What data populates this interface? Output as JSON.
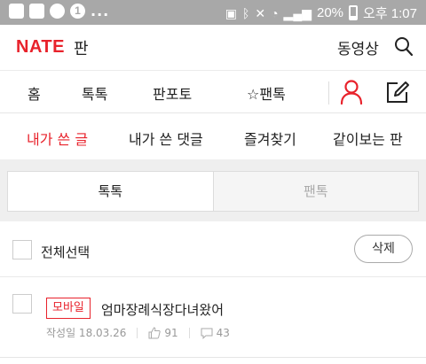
{
  "status_bar": {
    "notification_count": "1",
    "more": "...",
    "battery": "20%",
    "time": "오후 1:07"
  },
  "header": {
    "logo": "NATE",
    "logo_sub": "판",
    "video_label": "동영상"
  },
  "main_nav": {
    "items": [
      {
        "label": "홈"
      },
      {
        "label": "톡톡"
      },
      {
        "label": "판포토"
      },
      {
        "label": "☆팬톡"
      }
    ]
  },
  "sub_nav": {
    "items": [
      {
        "label": "내가 쓴 글",
        "active": true
      },
      {
        "label": "내가 쓴 댓글"
      },
      {
        "label": "즐겨찾기"
      },
      {
        "label": "같이보는 판"
      }
    ]
  },
  "tabs": [
    {
      "label": "톡톡",
      "active": true
    },
    {
      "label": "팬톡"
    }
  ],
  "select_all": {
    "label": "전체선택",
    "delete_label": "삭제"
  },
  "posts": [
    {
      "badge": "모바일",
      "title": "엄마장례식장다녀왔어",
      "date": "작성일 18.03.26",
      "likes": "91",
      "comments": "43"
    }
  ],
  "colors": {
    "accent": "#e8222b",
    "status_bar": "#a8a8a8"
  }
}
